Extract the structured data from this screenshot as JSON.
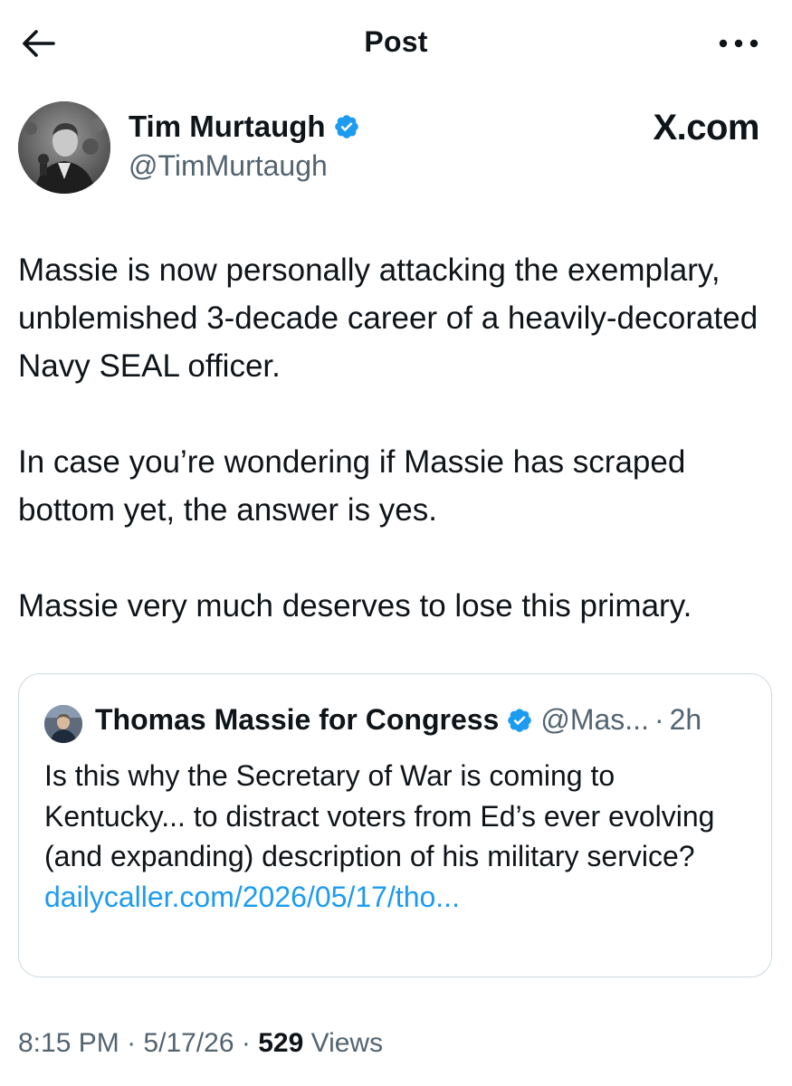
{
  "header": {
    "title": "Post"
  },
  "author": {
    "name": "Tim Murtaugh",
    "handle": "@TimMurtaugh"
  },
  "watermark": "X.com",
  "post": {
    "paragraphs": [
      "Massie is now personally attacking the exemplary, unblemished 3-decade career of a heavily-decorated Navy SEAL officer.",
      "In case you’re wondering if Massie has scraped bottom yet, the answer is yes.",
      "Massie very much deserves to lose this primary."
    ]
  },
  "quote": {
    "name": "Thomas Massie for Congress",
    "handle": "@Mas...",
    "separator": "·",
    "time": "2h",
    "text": "Is this why the Secretary of War is coming to Kentucky... to distract voters from Ed’s ever evolving (and expanding) description of his military service?",
    "link": "dailycaller.com/2026/05/17/tho..."
  },
  "meta": {
    "time": "8:15 PM",
    "sep1": "·",
    "date": "5/17/26",
    "sep2": "·",
    "views_count": "529",
    "views_label": "Views"
  },
  "colors": {
    "accent": "#1d9bf0",
    "text_primary": "#0f1419",
    "text_secondary": "#536471",
    "border": "#cfd9de"
  },
  "icons": {
    "back": "arrow-left-icon",
    "more": "more-horizontal-icon",
    "verified": "verified-badge-icon"
  }
}
